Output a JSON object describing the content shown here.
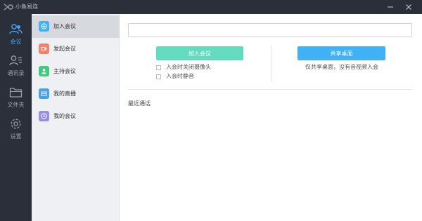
{
  "app": {
    "title": "小鱼易连"
  },
  "window": {
    "minimize_icon": "minimize-icon",
    "close_icon": "close-icon"
  },
  "rail": {
    "items": [
      {
        "label": "会议",
        "icon": "meeting-people-icon",
        "active": true
      },
      {
        "label": "通讯录",
        "icon": "contacts-icon",
        "active": false
      },
      {
        "label": "文件夹",
        "icon": "folder-icon",
        "active": false
      },
      {
        "label": "设置",
        "icon": "gear-icon",
        "active": false
      }
    ]
  },
  "menu": {
    "items": [
      {
        "label": "加入会议",
        "icon": "join-meeting-icon",
        "color": "#3fb1f4",
        "active": true
      },
      {
        "label": "发起会议",
        "icon": "start-meeting-icon",
        "color": "#f0846a",
        "active": false
      },
      {
        "label": "主持会议",
        "icon": "host-meeting-icon",
        "color": "#45c97f",
        "active": false
      },
      {
        "label": "我的直播",
        "icon": "live-icon",
        "color": "#4aa3e8",
        "active": false
      },
      {
        "label": "我的会议",
        "icon": "my-meetings-icon",
        "color": "#9b8ce6",
        "active": false
      }
    ]
  },
  "main": {
    "meeting_input": {
      "value": "",
      "placeholder": ""
    },
    "join_button": "加入会议",
    "options": [
      {
        "label": "入会时关闭摄像头",
        "checked": false
      },
      {
        "label": "入会时静音",
        "checked": false
      }
    ],
    "share_button": "共享桌面",
    "share_note": "仅共享桌面，没有音视频入会",
    "recent_title": "最近通话"
  },
  "colors": {
    "sidebar_bg": "#2b2f3a",
    "active_accent": "#3fa7ff",
    "join_button": "#64dbbd",
    "share_button": "#3fb1f4"
  }
}
